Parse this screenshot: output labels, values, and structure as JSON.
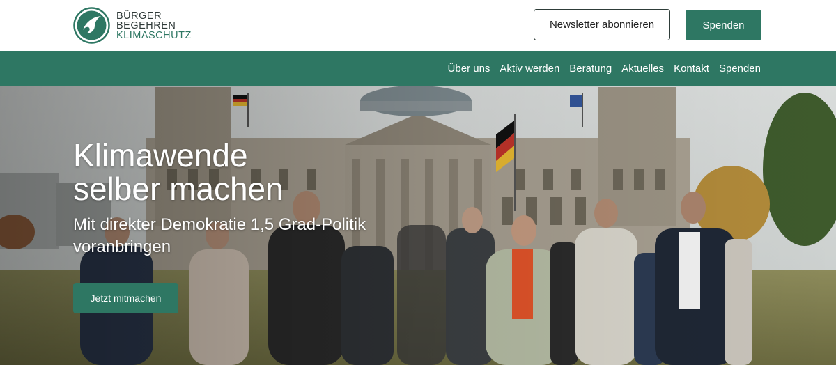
{
  "header": {
    "logo": {
      "line1": "BÜRGER",
      "line2": "BEGEHREN",
      "line3": "KLIMASCHUTZ"
    },
    "newsletter_label": "Newsletter abonnieren",
    "donate_label": "Spenden"
  },
  "nav": {
    "items": [
      {
        "label": "Über uns"
      },
      {
        "label": "Aktiv werden"
      },
      {
        "label": "Beratung"
      },
      {
        "label": "Aktuelles"
      },
      {
        "label": "Kontakt"
      },
      {
        "label": "Spenden"
      }
    ]
  },
  "hero": {
    "title_line1": "Klimawende",
    "title_line2": "selber machen",
    "subtitle": "Mit direkter Demokratie 1,5 Grad-Politik voranbringen",
    "cta_label": "Jetzt mitmachen"
  },
  "colors": {
    "brand_green": "#2e7763",
    "dark_text": "#2f3a38"
  }
}
